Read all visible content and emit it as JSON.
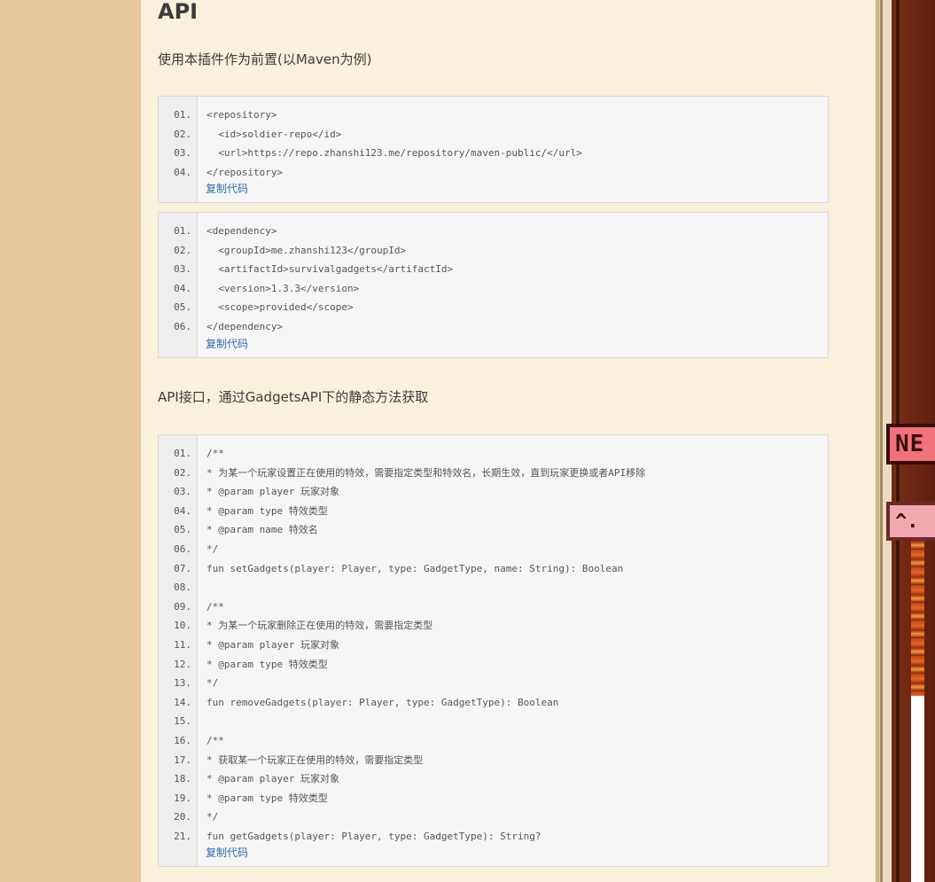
{
  "heading": "API",
  "intro": "使用本插件作为前置(以Maven为例)",
  "api_intro": "API接口，通过GadgetsAPI下的静态方法获取",
  "copy_label": "复制代码",
  "code_blocks": [
    {
      "lines": [
        "<repository>",
        "  <id>soldier-repo</id>",
        "  <url>https://repo.zhanshi123.me/repository/maven-public/</url>",
        "</repository>"
      ]
    },
    {
      "lines": [
        "<dependency>",
        "  <groupId>me.zhanshi123</groupId>",
        "  <artifactId>survivalgadgets</artifactId>",
        "  <version>1.3.3</version>",
        "  <scope>provided</scope>",
        "</dependency>"
      ]
    },
    {
      "lines": [
        "/**",
        "* 为某一个玩家设置正在使用的特效，需要指定类型和特效名，长期生效，直到玩家更换或者API移除",
        "* @param player 玩家对象",
        "* @param type 特效类型",
        "* @param name 特效名",
        "*/",
        "fun setGadgets(player: Player, type: GadgetType, name: String): Boolean",
        "",
        "/**",
        "* 为某一个玩家删除正在使用的特效，需要指定类型",
        "* @param player 玩家对象",
        "* @param type 特效类型",
        "*/",
        "fun removeGadgets(player: Player, type: GadgetType): Boolean",
        "",
        "/**",
        "* 获取某一个玩家正在使用的特效，需要指定类型",
        "* @param player 玩家对象",
        "* @param type 特效类型",
        "*/",
        "fun getGadgets(player: Player, type: GadgetType): String?"
      ]
    }
  ],
  "side_badges": {
    "new": "NE",
    "hot": "^."
  }
}
